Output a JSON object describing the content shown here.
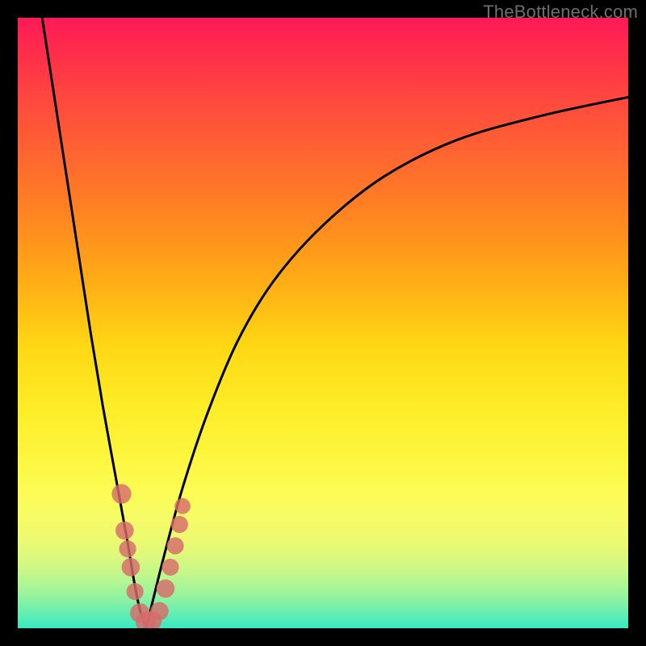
{
  "watermark": "TheBottleneck.com",
  "colors": {
    "frame": "#000000",
    "curve": "#000000",
    "dot": "#d76b6b",
    "gradient_top": "#ff1a57",
    "gradient_mid": "#fded28",
    "gradient_bottom": "#38e9c1"
  },
  "chart_data": {
    "type": "line",
    "title": "",
    "xlabel": "",
    "ylabel": "",
    "xlim": [
      0,
      100
    ],
    "ylim": [
      0,
      100
    ],
    "grid": false,
    "legend": false,
    "note": "Axes are implicit (no tick labels). Values below are visual estimates: x = horizontal % across plot, y = vertical % of plot height (0 at bottom / green, 100 at top / red).",
    "series": [
      {
        "name": "left-branch",
        "x": [
          4,
          6,
          8,
          10,
          12,
          14,
          16,
          18,
          19,
          20,
          21
        ],
        "y": [
          100,
          87,
          74,
          61,
          48,
          36,
          25,
          14,
          8,
          3,
          0
        ]
      },
      {
        "name": "right-branch",
        "x": [
          21,
          22,
          24,
          27,
          31,
          36,
          42,
          50,
          60,
          72,
          86,
          100
        ],
        "y": [
          0,
          4,
          12,
          23,
          35,
          47,
          57,
          66,
          74,
          80,
          84,
          87
        ]
      }
    ],
    "scatter": {
      "name": "dots-near-vertex",
      "points": [
        {
          "x": 17.0,
          "y": 22.0,
          "r": 1.6
        },
        {
          "x": 17.5,
          "y": 16.0,
          "r": 1.5
        },
        {
          "x": 18.0,
          "y": 13.0,
          "r": 1.4
        },
        {
          "x": 18.5,
          "y": 10.0,
          "r": 1.5
        },
        {
          "x": 19.2,
          "y": 6.0,
          "r": 1.4
        },
        {
          "x": 20.0,
          "y": 2.5,
          "r": 1.6
        },
        {
          "x": 21.0,
          "y": 1.0,
          "r": 1.7
        },
        {
          "x": 22.0,
          "y": 1.2,
          "r": 1.6
        },
        {
          "x": 23.2,
          "y": 2.8,
          "r": 1.5
        },
        {
          "x": 24.2,
          "y": 6.5,
          "r": 1.5
        },
        {
          "x": 25.0,
          "y": 10.0,
          "r": 1.4
        },
        {
          "x": 25.8,
          "y": 13.5,
          "r": 1.4
        },
        {
          "x": 26.5,
          "y": 17.0,
          "r": 1.4
        },
        {
          "x": 27.0,
          "y": 20.0,
          "r": 1.3
        }
      ]
    }
  }
}
